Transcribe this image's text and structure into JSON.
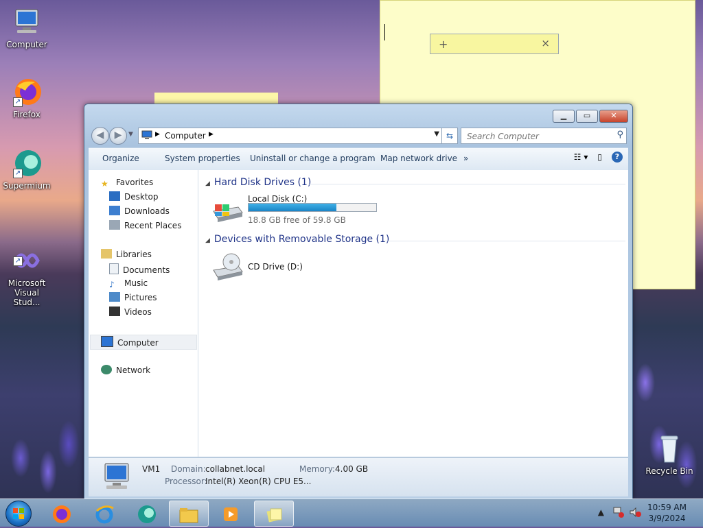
{
  "desktop": {
    "icons": [
      {
        "label": "Computer"
      },
      {
        "label": "Firefox"
      },
      {
        "label": "Supermium"
      },
      {
        "label": "Microsoft\nVisual Stud..."
      },
      {
        "label": "Recycle Bin"
      }
    ]
  },
  "sticky_note": {
    "add_icon": "+",
    "close_icon": "×"
  },
  "window": {
    "address": {
      "crumb": "Computer"
    },
    "search": {
      "placeholder": "Search Computer"
    },
    "toolbar": {
      "organize": "Organize",
      "system_properties": "System properties",
      "uninstall": "Uninstall or change a program",
      "map_drive": "Map network drive",
      "more": "»"
    },
    "nav": {
      "favorites": "Favorites",
      "desktop": "Desktop",
      "downloads": "Downloads",
      "recent": "Recent Places",
      "libraries": "Libraries",
      "documents": "Documents",
      "music": "Music",
      "pictures": "Pictures",
      "videos": "Videos",
      "computer": "Computer",
      "network": "Network"
    },
    "groups": {
      "hdd": "Hard Disk Drives (1)",
      "removable": "Devices with Removable Storage (1)"
    },
    "drives": {
      "c_name": "Local Disk (C:)",
      "c_free": "18.8 GB free of 59.8 GB",
      "c_used_fraction": 0.69,
      "d_name": "CD Drive (D:)"
    },
    "details": {
      "name": "VM1",
      "domain_label": "Domain:",
      "domain_value": "collabnet.local",
      "memory_label": "Memory:",
      "memory_value": "4.00 GB",
      "processor_label": "Processor:",
      "processor_value": "Intel(R) Xeon(R) CPU E5..."
    }
  },
  "taskbar": {
    "time": "10:59 AM",
    "date": "3/9/2024",
    "tray_arrow": "▲"
  }
}
